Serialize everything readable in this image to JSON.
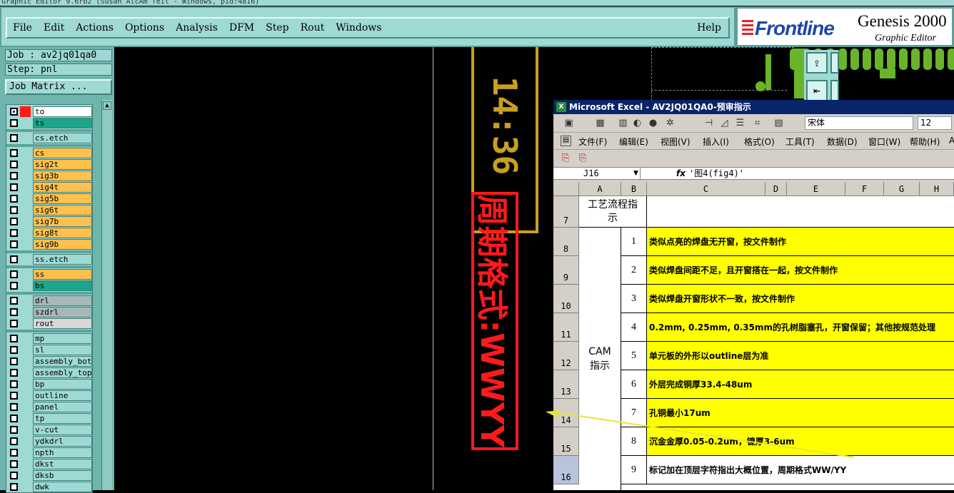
{
  "window": {
    "title": "Graphic Editor 9.6rb2 (Susan AlcAm feit - Windows, pid:4816)"
  },
  "menu": {
    "file": "File",
    "edit": "Edit",
    "actions": "Actions",
    "options": "Options",
    "analysis": "Analysis",
    "dfm": "DFM",
    "step": "Step",
    "rout": "Rout",
    "windows": "Windows",
    "help": "Help"
  },
  "logo": {
    "brand": "Frontline",
    "product": "Genesis 2000",
    "subtitle": "Graphic Editor"
  },
  "info": {
    "job": "Job : av2jq01qa0",
    "step": "Step: pnl",
    "job_matrix": "Job Matrix ..."
  },
  "layers": [
    {
      "name": "to",
      "color": "#ffffff"
    },
    {
      "name": "ts",
      "color": "#1aa68a"
    },
    {
      "name": "cs.etch",
      "color": "#9fd9d4"
    },
    {
      "name": "cs",
      "color": "#ffc04d"
    },
    {
      "name": "sig2t",
      "color": "#ffc04d"
    },
    {
      "name": "sig3b",
      "color": "#ffc04d"
    },
    {
      "name": "sig4t",
      "color": "#ffc04d"
    },
    {
      "name": "sig5b",
      "color": "#ffc04d"
    },
    {
      "name": "sig6t",
      "color": "#ffc04d"
    },
    {
      "name": "sig7b",
      "color": "#ffc04d"
    },
    {
      "name": "sig8t",
      "color": "#ffc04d"
    },
    {
      "name": "sig9b",
      "color": "#ffc04d"
    },
    {
      "name": "ss.etch",
      "color": "#9fd9d4"
    },
    {
      "name": "ss",
      "color": "#ffc04d"
    },
    {
      "name": "bs",
      "color": "#1aa68a"
    },
    {
      "name": "drl",
      "color": "#a8b8b8"
    },
    {
      "name": "szdrl",
      "color": "#a8b8b8"
    },
    {
      "name": "rout",
      "color": "#d8d8d8"
    },
    {
      "name": "mp",
      "color": "#9fd9d4"
    },
    {
      "name": "sl",
      "color": "#9fd9d4"
    },
    {
      "name": "assembly_bot",
      "color": "#9fd9d4"
    },
    {
      "name": "assembly_top",
      "color": "#9fd9d4"
    },
    {
      "name": "bp",
      "color": "#9fd9d4"
    },
    {
      "name": "outline",
      "color": "#9fd9d4"
    },
    {
      "name": "panel",
      "color": "#9fd9d4"
    },
    {
      "name": "tp",
      "color": "#9fd9d4"
    },
    {
      "name": "v-cut",
      "color": "#9fd9d4"
    },
    {
      "name": "ydkdrl",
      "color": "#9fd9d4"
    },
    {
      "name": "npth",
      "color": "#9fd9d4"
    },
    {
      "name": "dkst",
      "color": "#9fd9d4"
    },
    {
      "name": "dksb",
      "color": "#9fd9d4"
    },
    {
      "name": "dwk",
      "color": "#9fd9d4"
    }
  ],
  "canvas": {
    "time_text": "14:36",
    "date_code_text": "周期格式:WWYY"
  },
  "excel": {
    "title": "Microsoft Excel - AV2JQ01QA0-预审指示",
    "font": "宋体",
    "size": "12",
    "menu": [
      "文件(F)",
      "编辑(E)",
      "视图(V)",
      "插入(I)",
      "格式(O)",
      "工具(T)",
      "数据(D)",
      "窗口(W)",
      "帮助(H)",
      "A"
    ],
    "name_box": "J16",
    "fx": "fx",
    "formula": "'图4(fig4)'",
    "columns": [
      "A",
      "B",
      "C",
      "D",
      "E",
      "F",
      "G",
      "H"
    ],
    "header_cell": "工艺流程指示",
    "group_label": "CAM指示",
    "rows": [
      {
        "row": "7",
        "no": "",
        "text": ""
      },
      {
        "row": "8",
        "no": "1",
        "text": "类似点亮的焊盘无开窗，按文件制作"
      },
      {
        "row": "9",
        "no": "2",
        "text": "类似焊盘间距不足，且开窗搭在一起，按文件制作"
      },
      {
        "row": "10",
        "no": "3",
        "text": "类似焊盘开窗形状不一致，按文件制作"
      },
      {
        "row": "11",
        "no": "4",
        "text": "0.2mm, 0.25mm, 0.35mm的孔树脂塞孔，开窗保留；其他按规范处理"
      },
      {
        "row": "12",
        "no": "5",
        "text": "单元板的外形以outline层为准"
      },
      {
        "row": "13",
        "no": "6",
        "text": "外层完成铜厚33.4-48um"
      },
      {
        "row": "14",
        "no": "7",
        "text": "孔铜最小17um"
      },
      {
        "row": "15",
        "no": "8",
        "text": "沉金金厚0.05-0.2um，镍厚3-6um"
      },
      {
        "row": "16",
        "no": "9",
        "text": "标记加在顶层字符指出大概位置，周期格式WW/YY"
      }
    ]
  },
  "colors": {
    "panel": "#9fd9d4",
    "accent_red": "#ff1a1a",
    "accent_gold": "#c8a01e",
    "highlight_yellow": "#ffff00"
  }
}
